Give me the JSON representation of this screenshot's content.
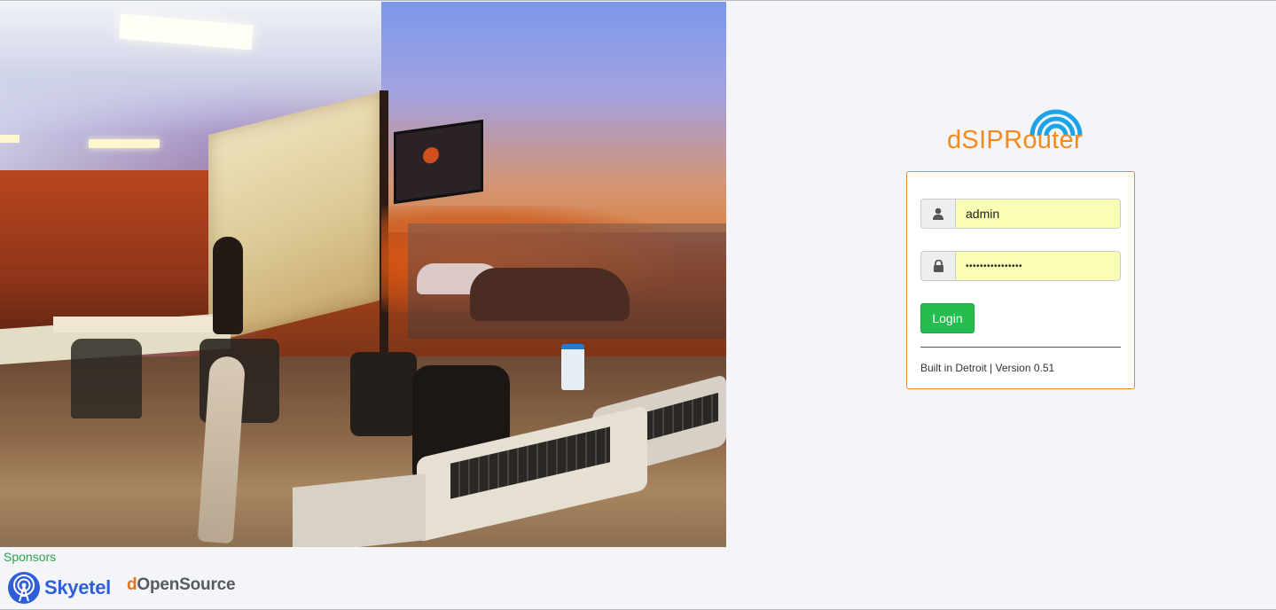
{
  "hero": {
    "description_icon": "office-photo"
  },
  "brand": {
    "logo_text": "dSIPRouter",
    "logo_color": "#f28a1e",
    "arc_color": "#1aa3e8"
  },
  "login": {
    "username_value": "admin",
    "password_value": "••••••••••••••••",
    "username_icon": "user-icon",
    "password_icon": "lock-icon",
    "login_label": "Login",
    "footer": "Built in Detroit | Version 0.51",
    "card_border_color": "#e98a2c",
    "button_color": "#24bd4e",
    "field_bg_color": "#fafdb4"
  },
  "sponsors": {
    "label": "Sponsors",
    "skyetel": "Skyetel",
    "dopensource_prefix": "d",
    "dopensource_rest": "OpenSource"
  }
}
